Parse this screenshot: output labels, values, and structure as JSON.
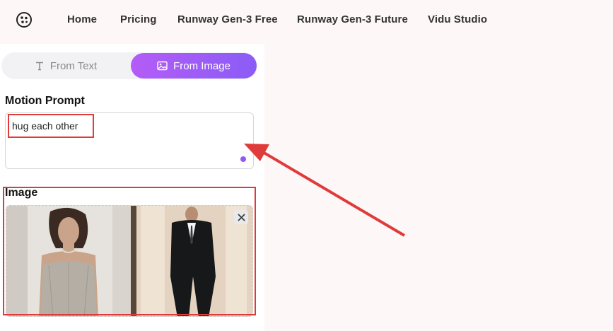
{
  "nav": {
    "items": [
      "Home",
      "Pricing",
      "Runway Gen-3 Free",
      "Runway Gen-3 Future",
      "Vidu Studio"
    ]
  },
  "tabs": {
    "text_label": "From Text",
    "image_label": "From Image"
  },
  "prompt": {
    "label": "Motion Prompt",
    "value": "hug each other"
  },
  "image": {
    "label": "Image"
  },
  "colors": {
    "accent": "#8b5cf6",
    "accent_start": "#b45cf7",
    "annotation": "#e03b3b",
    "page_bg": "#fdf8f7"
  },
  "icons": {
    "logo": "film-reel-icon",
    "text_tab": "text-t-icon",
    "image_tab": "image-icon",
    "remove": "close-icon"
  }
}
